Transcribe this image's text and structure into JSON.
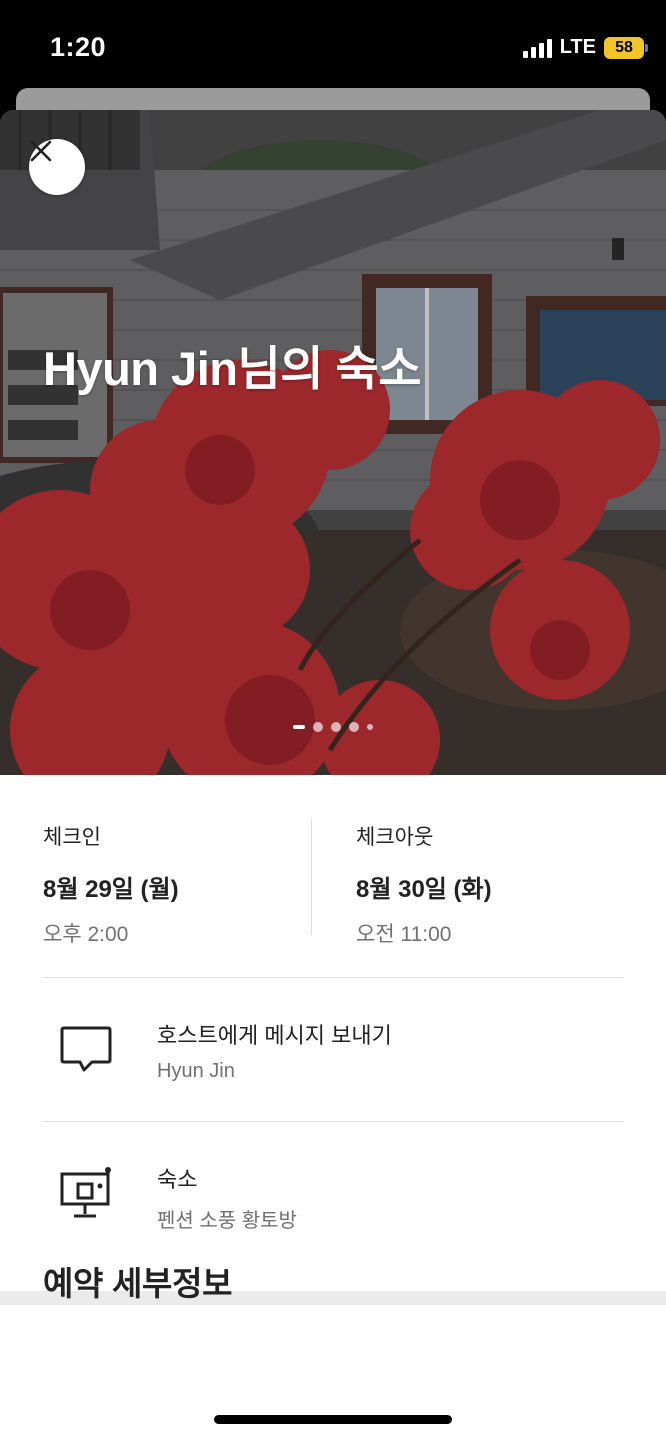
{
  "status_bar": {
    "time": "1:20",
    "network": "LTE",
    "battery": "58"
  },
  "hero": {
    "title": "Hyun Jin님의 숙소",
    "photo_icon": "house-with-red-azalea-photo",
    "pager_count": 5,
    "pager_active": 0
  },
  "checkin": {
    "label": "체크인",
    "date": "8월 29일 (월)",
    "time": "오후 2:00"
  },
  "checkout": {
    "label": "체크아웃",
    "date": "8월 30일 (화)",
    "time": "오전 11:00"
  },
  "message_row": {
    "icon": "message-bubble-icon",
    "title": "호스트에게 메시지 보내기",
    "subtitle": "Hyun Jin"
  },
  "listing_row": {
    "icon": "listing-presentation-icon",
    "title": "숙소",
    "subtitle": "펜션 소풍 황토방"
  },
  "details": {
    "title": "예약 세부정보"
  },
  "colors": {
    "text_primary": "#222222",
    "text_secondary": "#717171",
    "divider": "#dddddd",
    "battery": "#f2c529"
  }
}
